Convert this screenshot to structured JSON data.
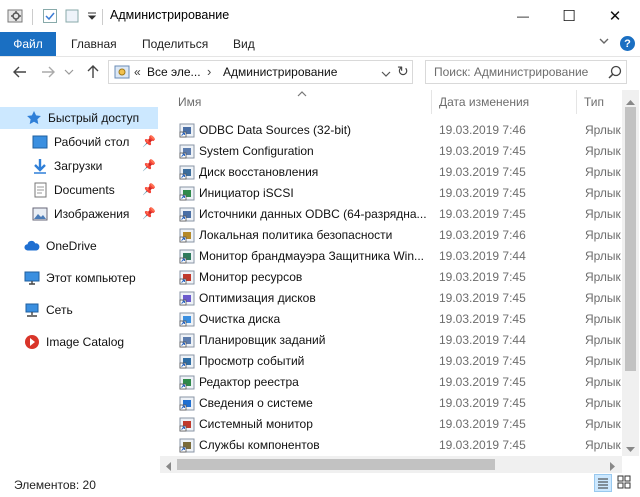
{
  "window": {
    "title": "Администрирование",
    "minimize": "—",
    "maximize": "☐",
    "close": "✕"
  },
  "ribbon": {
    "file": "Файл",
    "tabs": [
      "Главная",
      "Поделиться",
      "Вид"
    ],
    "expand": "⌄",
    "help": "?"
  },
  "address": {
    "prefix": "«",
    "crumb1": "Все эле...",
    "sep": "›",
    "crumb2": "Администрирование",
    "refresh": "↻"
  },
  "search": {
    "placeholder": "Поиск: Администрирование",
    "icon": "search-icon"
  },
  "nav": {
    "quick_access": "Быстрый доступ",
    "desktop": "Рабочий стол",
    "downloads": "Загрузки",
    "documents": "Documents",
    "images": "Изображения",
    "onedrive": "OneDrive",
    "this_pc": "Этот компьютер",
    "network": "Сеть",
    "image_catalog": "Image Catalog"
  },
  "columns": {
    "name": "Имя",
    "date": "Дата изменения",
    "type": "Тип"
  },
  "files": [
    {
      "name": "ODBC Data Sources (32-bit)",
      "date": "19.03.2019 7:46",
      "type": "Ярлык"
    },
    {
      "name": "System Configuration",
      "date": "19.03.2019 7:45",
      "type": "Ярлык"
    },
    {
      "name": "Диск восстановления",
      "date": "19.03.2019 7:45",
      "type": "Ярлык"
    },
    {
      "name": "Инициатор iSCSI",
      "date": "19.03.2019 7:45",
      "type": "Ярлык"
    },
    {
      "name": "Источники данных ODBC (64-разрядна...",
      "date": "19.03.2019 7:45",
      "type": "Ярлык"
    },
    {
      "name": "Локальная политика безопасности",
      "date": "19.03.2019 7:46",
      "type": "Ярлык"
    },
    {
      "name": "Монитор брандмауэра Защитника Win...",
      "date": "19.03.2019 7:44",
      "type": "Ярлык"
    },
    {
      "name": "Монитор ресурсов",
      "date": "19.03.2019 7:45",
      "type": "Ярлык"
    },
    {
      "name": "Оптимизация дисков",
      "date": "19.03.2019 7:45",
      "type": "Ярлык"
    },
    {
      "name": "Очистка диска",
      "date": "19.03.2019 7:45",
      "type": "Ярлык"
    },
    {
      "name": "Планировщик заданий",
      "date": "19.03.2019 7:44",
      "type": "Ярлык"
    },
    {
      "name": "Просмотр событий",
      "date": "19.03.2019 7:45",
      "type": "Ярлык"
    },
    {
      "name": "Редактор реестра",
      "date": "19.03.2019 7:45",
      "type": "Ярлык"
    },
    {
      "name": "Сведения о системе",
      "date": "19.03.2019 7:45",
      "type": "Ярлык"
    },
    {
      "name": "Системный монитор",
      "date": "19.03.2019 7:45",
      "type": "Ярлык"
    },
    {
      "name": "Службы компонентов",
      "date": "19.03.2019 7:45",
      "type": "Ярлык"
    }
  ],
  "status": {
    "count": "Элементов: 20"
  },
  "colors": {
    "accent": "#1a6fc2",
    "selected": "#cce8ff"
  }
}
